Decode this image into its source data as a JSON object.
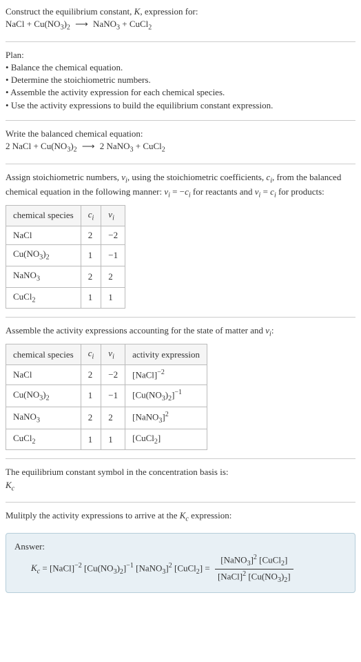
{
  "prompt": {
    "line1": "Construct the equilibrium constant, K, expression for:",
    "eq_unbalanced": "NaCl + Cu(NO₃)₂ ⟶ NaNO₃ + CuCl₂"
  },
  "plan": {
    "heading": "Plan:",
    "bullets": [
      "Balance the chemical equation.",
      "Determine the stoichiometric numbers.",
      "Assemble the activity expression for each chemical species.",
      "Use the activity expressions to build the equilibrium constant expression."
    ]
  },
  "balanced": {
    "heading": "Write the balanced chemical equation:",
    "eq": "2 NaCl + Cu(NO₃)₂ ⟶ 2 NaNO₃ + CuCl₂"
  },
  "stoich": {
    "intro": "Assign stoichiometric numbers, νᵢ, using the stoichiometric coefficients, cᵢ, from the balanced chemical equation in the following manner: νᵢ = −cᵢ for reactants and νᵢ = cᵢ for products:",
    "headers": [
      "chemical species",
      "cᵢ",
      "νᵢ"
    ],
    "rows": [
      [
        "NaCl",
        "2",
        "−2"
      ],
      [
        "Cu(NO₃)₂",
        "1",
        "−1"
      ],
      [
        "NaNO₃",
        "2",
        "2"
      ],
      [
        "CuCl₂",
        "1",
        "1"
      ]
    ]
  },
  "activity": {
    "intro": "Assemble the activity expressions accounting for the state of matter and νᵢ:",
    "headers": [
      "chemical species",
      "cᵢ",
      "νᵢ",
      "activity expression"
    ],
    "rows": [
      [
        "NaCl",
        "2",
        "−2",
        "[NaCl]⁻²"
      ],
      [
        "Cu(NO₃)₂",
        "1",
        "−1",
        "[Cu(NO₃)₂]⁻¹"
      ],
      [
        "NaNO₃",
        "2",
        "2",
        "[NaNO₃]²"
      ],
      [
        "CuCl₂",
        "1",
        "1",
        "[CuCl₂]"
      ]
    ]
  },
  "symbol": {
    "line1": "The equilibrium constant symbol in the concentration basis is:",
    "line2": "K_c"
  },
  "multiply": {
    "line": "Mulitply the activity expressions to arrive at the K_c expression:"
  },
  "answer": {
    "label": "Answer:",
    "kc": "K_c",
    "eq1": "= [NaCl]⁻² [Cu(NO₃)₂]⁻¹ [NaNO₃]² [CuCl₂] =",
    "frac_num": "[NaNO₃]² [CuCl₂]",
    "frac_den": "[NaCl]² [Cu(NO₃)₂]"
  }
}
